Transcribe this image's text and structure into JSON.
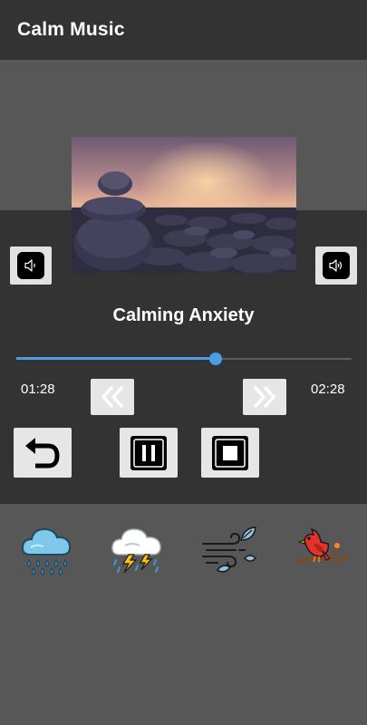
{
  "app": {
    "title": "Calm Music"
  },
  "player": {
    "track_title": "Calming Anxiety",
    "elapsed": "01:28",
    "total": "02:28",
    "progress": 0.594
  },
  "controls": {
    "volume_down_icon": "volume-down-icon",
    "volume_up_icon": "volume-up-icon",
    "rewind_icon": "double-chevron-left-icon",
    "forward_icon": "double-chevron-right-icon",
    "replay_icon": "undo-arrow-icon",
    "pause_icon": "pause-icon",
    "stop_icon": "stop-icon"
  },
  "sounds": [
    {
      "icon": "rain-cloud-icon"
    },
    {
      "icon": "thunderstorm-icon"
    },
    {
      "icon": "wind-leaves-icon"
    },
    {
      "icon": "bird-on-branch-icon"
    }
  ],
  "colors": {
    "app_bar": "#333333",
    "background": "#575757",
    "player_panel": "#333333",
    "accent": "#4a9ee8"
  }
}
